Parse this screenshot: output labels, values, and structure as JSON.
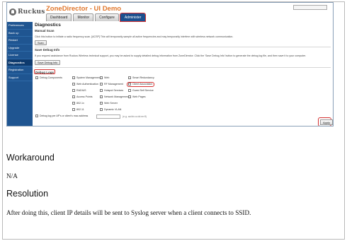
{
  "colors": {
    "sidebar": "#1f5591",
    "active_tab": "#1d4f8e",
    "title_orange": "#e0762b",
    "highlight_red": "#d43030"
  },
  "app": {
    "logo_text": "Ruckus",
    "title": "ZoneDirector - UI Demo",
    "tabs": [
      {
        "label": "Dashboard"
      },
      {
        "label": "Monitor"
      },
      {
        "label": "Configure"
      },
      {
        "label": "Administer"
      }
    ],
    "active_tab": "Administer"
  },
  "sidebar": {
    "items": [
      {
        "label": "Preferences"
      },
      {
        "label": "Back up"
      },
      {
        "label": "Restart"
      },
      {
        "label": "Upgrade"
      },
      {
        "label": "License"
      },
      {
        "label": "Diagnostics"
      },
      {
        "label": "Registration"
      },
      {
        "label": "Support"
      }
    ],
    "active": "Diagnostics"
  },
  "main": {
    "title": "Diagnostics",
    "manual_scan": {
      "title": "Manual Scan",
      "desc": "Click this button to initiate a radio frequency scan. [ACSP] This will temporarily sample all active frequencies and may temporarily interfere with wireless network communication.",
      "button": "Scan"
    },
    "save_debug": {
      "title": "Save Debug Info",
      "desc": "If you request assistance from Ruckus Wireless technical support, you may be asked to supply detailed debug information from ZoneDirector. Click the 'Save Debug Info' button to generate the debug log file, and then save it to your computer.",
      "button": "Save Debug Info"
    },
    "debug_logs": {
      "title": "Debug Logs",
      "components_label": "Debug Components",
      "columns": [
        [
          "System Management",
          "Web Authentication",
          "RADIUS",
          "Access Points",
          "802.1x",
          "802.11"
        ],
        [
          "Web",
          "RF Management",
          "Hotspot Services",
          "Network Management",
          "Web Server",
          "Dynamic VLAN"
        ],
        [
          "Smart Redundancy",
          "Client Association",
          "Guest Self Service",
          "Web Pages"
        ]
      ],
      "mac_label": "Debug log per AP's or client's mac address",
      "mac_hint": "(e.g. aa:bb:cc:dd:ee:ff)",
      "apply_button": "Apply"
    }
  },
  "document": {
    "workaround_heading": "Workaround",
    "workaround_text": "N/A",
    "resolution_heading": "Resolution",
    "resolution_text": "After doing this, client IP details will be sent to Syslog server when a client connects to SSID."
  }
}
